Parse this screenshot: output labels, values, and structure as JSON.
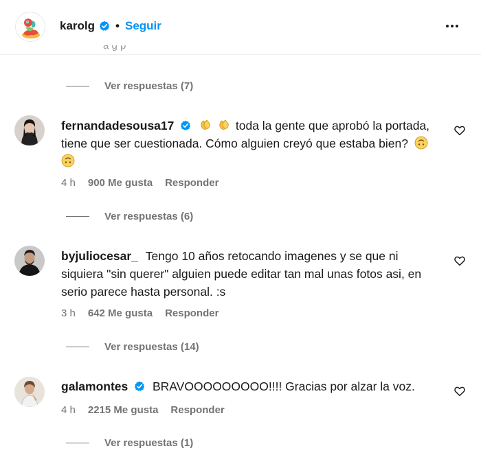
{
  "header": {
    "username": "karolg",
    "separator": "•",
    "follow_label": "Seguir",
    "more_icon": "more-horizontal-icon"
  },
  "top_cutoff_text": "a   g   p",
  "top_replies": "Ver respuestas (7)",
  "comments": [
    {
      "username": "fernandadesousa17",
      "verified": true,
      "emoji_prefix": "clapping-hands",
      "text": "toda la gente que aprobó la portada, tiene que ser cuestionada. Cómo alguien creyó que estaba bien?",
      "emoji_suffix": "upside-down-face",
      "time": "4 h",
      "likes": "900 Me gusta",
      "reply_label": "Responder",
      "replies": "Ver respuestas (6)"
    },
    {
      "username": "byjuliocesar_",
      "verified": false,
      "text": "Tengo 10 años retocando imagenes y se que ni siquiera \"sin querer\" alguien puede editar tan mal unas fotos asi, en serio parece hasta personal. :s",
      "time": "3 h",
      "likes": "642 Me gusta",
      "reply_label": "Responder",
      "replies": "Ver respuestas (14)"
    },
    {
      "username": "galamontes",
      "verified": true,
      "text": "BRAVOOOOOOOOO!!!! Gracias por alzar la voz.",
      "time": "4 h",
      "likes": "2215 Me gusta",
      "reply_label": "Responder",
      "replies": "Ver respuestas (1)"
    }
  ],
  "colors": {
    "accent": "#0095f6",
    "verified": "#0095f6",
    "muted": "#737373",
    "text": "#1a1a1a"
  }
}
